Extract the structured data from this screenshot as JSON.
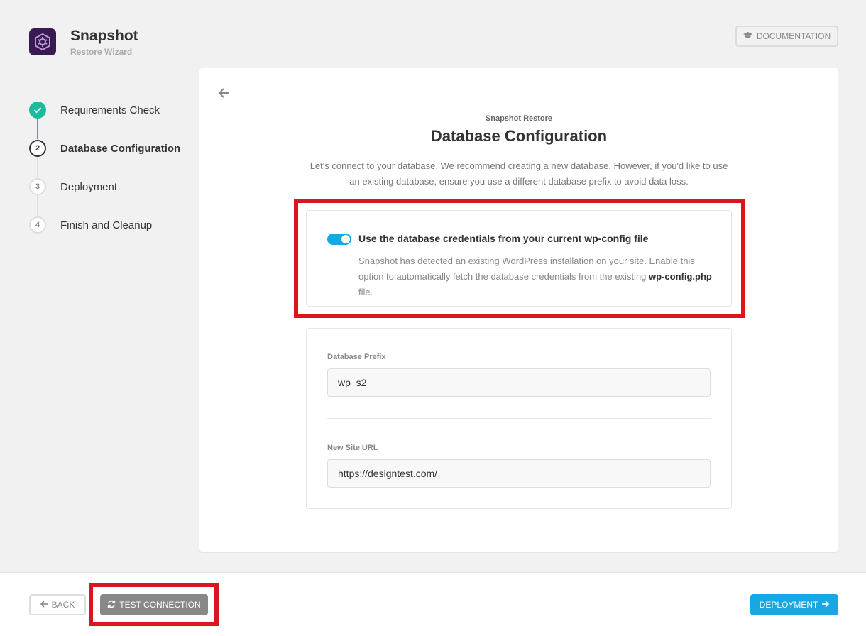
{
  "app": {
    "title": "Snapshot",
    "subtitle": "Restore Wizard",
    "documentation_label": "DOCUMENTATION"
  },
  "steps": [
    {
      "number": "",
      "label": "Requirements Check",
      "status": "complete"
    },
    {
      "number": "2",
      "label": "Database Configuration",
      "status": "current"
    },
    {
      "number": "3",
      "label": "Deployment",
      "status": "pending"
    },
    {
      "number": "4",
      "label": "Finish and Cleanup",
      "status": "pending"
    }
  ],
  "main": {
    "eyebrow": "Snapshot Restore",
    "title": "Database Configuration",
    "description": "Let's connect to your database. We recommend creating a new database. However, if you'd like to use an existing database, ensure you use a different database prefix to avoid data loss."
  },
  "toggle": {
    "enabled": true,
    "label": "Use the database credentials from your current wp-config file",
    "description_prefix": "Snapshot has detected an existing WordPress installation on your site. Enable this option to automatically fetch the database credentials from the existing ",
    "description_file": "wp-config.php",
    "description_suffix": " file."
  },
  "form": {
    "prefix_label": "Database Prefix",
    "prefix_value": "wp_s2_",
    "url_label": "New Site URL",
    "url_value": "https://designtest.com/"
  },
  "footer": {
    "back_label": "BACK",
    "test_label": "TEST CONNECTION",
    "deploy_label": "DEPLOYMENT"
  },
  "colors": {
    "accent": "#17a8e3",
    "success": "#1abc9c",
    "logo_bg": "#3a1a52",
    "highlight": "#d9161c"
  }
}
